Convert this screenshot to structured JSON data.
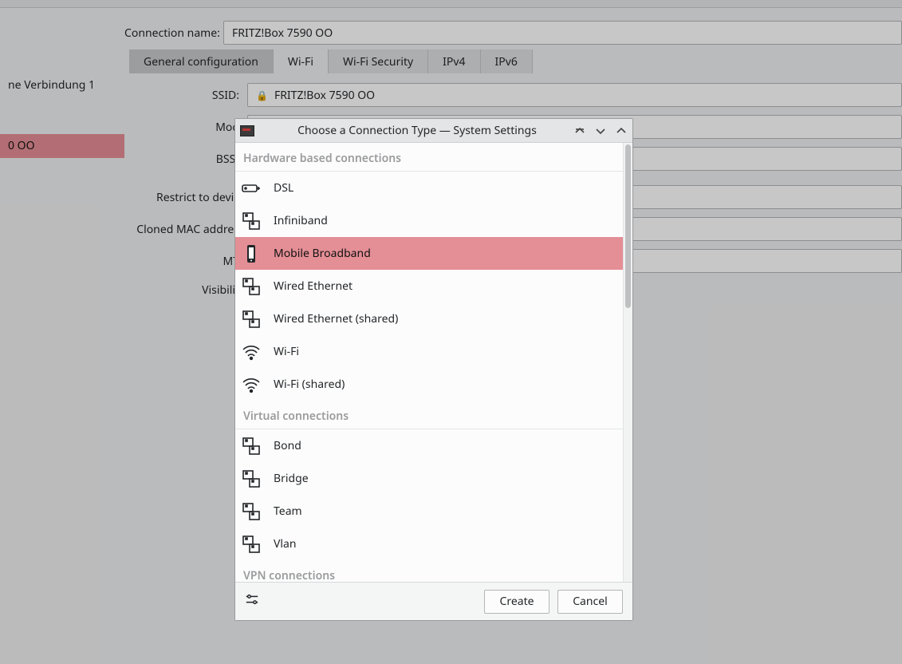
{
  "sidebar": {
    "items": [
      {
        "label": "ne Verbindung 1"
      },
      {
        "label": "0 OO"
      }
    ]
  },
  "form": {
    "connection_name_label": "Connection name:",
    "connection_name_value": "FRITZ!Box 7590 OO",
    "tabs": {
      "general": "General configuration",
      "wifi": "Wi-Fi",
      "wifisec": "Wi-Fi Security",
      "ipv4": "IPv4",
      "ipv6": "IPv6"
    },
    "labels": {
      "ssid": "SSID:",
      "mode": "Mod",
      "bssid": "BSSI",
      "restrict": "Restrict to devic",
      "cloned": "Cloned MAC addres",
      "mtu": "MT",
      "visibility": "Visibilit"
    },
    "ssid_value": "FRITZ!Box 7590 OO"
  },
  "dialog": {
    "title": "Choose a Connection Type — System Settings",
    "sections": {
      "hardware": "Hardware based connections",
      "virtual": "Virtual connections",
      "vpn": "VPN connections"
    },
    "hardware_items": [
      {
        "id": "dsl",
        "label": "DSL"
      },
      {
        "id": "infiniband",
        "label": "Infiniband"
      },
      {
        "id": "mobile-broadband",
        "label": "Mobile Broadband",
        "selected": true
      },
      {
        "id": "wired-ethernet",
        "label": "Wired Ethernet"
      },
      {
        "id": "wired-ethernet-shared",
        "label": "Wired Ethernet (shared)"
      },
      {
        "id": "wifi",
        "label": "Wi-Fi"
      },
      {
        "id": "wifi-shared",
        "label": "Wi-Fi (shared)"
      }
    ],
    "virtual_items": [
      {
        "id": "bond",
        "label": "Bond"
      },
      {
        "id": "bridge",
        "label": "Bridge"
      },
      {
        "id": "team",
        "label": "Team"
      },
      {
        "id": "vlan",
        "label": "Vlan"
      }
    ],
    "buttons": {
      "create": "Create",
      "cancel": "Cancel"
    }
  }
}
